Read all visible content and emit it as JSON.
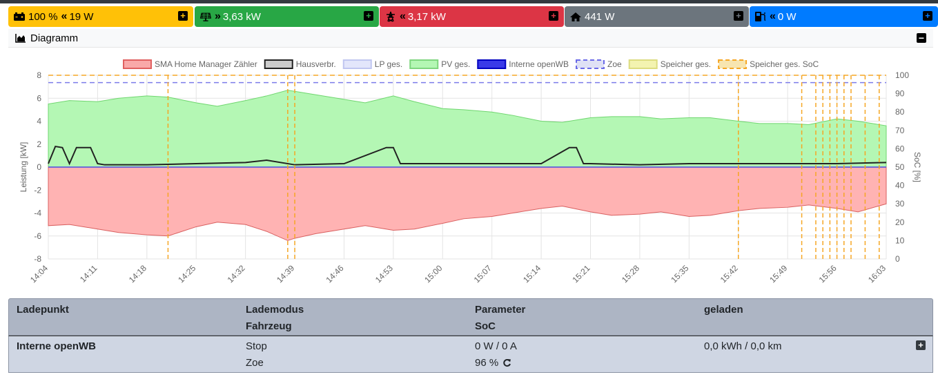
{
  "tiles": {
    "battery": {
      "value": "100 %",
      "arrow": "«",
      "power": "19 W",
      "icon": "car-battery-icon",
      "color": "#ffc107"
    },
    "pv": {
      "arrow": "»",
      "power": "3,63 kW",
      "icon": "solar-panel-icon",
      "color": "#28a745"
    },
    "grid": {
      "arrow": "«",
      "power": "3,17 kW",
      "icon": "transmission-tower-icon",
      "color": "#dc3545"
    },
    "house": {
      "power": "441 W",
      "icon": "house-icon",
      "color": "#6c757d"
    },
    "chargepoint": {
      "arrow": "«",
      "power": "0 W",
      "icon": "charging-station-icon",
      "color": "#007bff"
    }
  },
  "diagram": {
    "title": "Diagramm",
    "icon": "area-chart-icon"
  },
  "chart_data": {
    "type": "area",
    "legend": [
      {
        "name": "SMA Home Manager Zähler",
        "color": "#f9a9a9",
        "border": "#e06060",
        "dashed": false
      },
      {
        "name": "Hausverbr.",
        "color": "#cccccc",
        "border": "#222222",
        "dashed": false
      },
      {
        "name": "LP ges.",
        "color": "#e3e6fb",
        "border": "#c0c6f0",
        "dashed": false
      },
      {
        "name": "PV ges.",
        "color": "#b4f7b4",
        "border": "#7ed67e",
        "dashed": false
      },
      {
        "name": "Interne openWB",
        "color": "#3a3ae8",
        "border": "#0000c0",
        "dashed": false
      },
      {
        "name": "Zoe",
        "color": "#dfe1f5",
        "border": "#6a6ae8",
        "dashed": true
      },
      {
        "name": "Speicher ges.",
        "color": "#f3f3b0",
        "border": "#dcdc80",
        "dashed": false
      },
      {
        "name": "Speicher ges. SoC",
        "color": "#f7e5b0",
        "border": "#f5a623",
        "dashed": true
      }
    ],
    "legend_position": "top",
    "ylabel": "Leistung [kW]",
    "ylim": [
      -8,
      8
    ],
    "yticks": [
      "8",
      "6",
      "4",
      "2",
      "0",
      "-2",
      "-4",
      "-6",
      "-8"
    ],
    "y2label": "SoC [%]",
    "y2lim": [
      0,
      100
    ],
    "y2ticks": [
      "100",
      "90",
      "80",
      "70",
      "60",
      "50",
      "40",
      "30",
      "20",
      "10",
      "0"
    ],
    "xticks": [
      "14:04",
      "14:11",
      "14:18",
      "14:25",
      "14:32",
      "14:39",
      "14:46",
      "14:53",
      "15:00",
      "15:07",
      "15:14",
      "15:21",
      "15:28",
      "15:35",
      "15:42",
      "15:49",
      "15:56",
      "16:03"
    ],
    "grid": true,
    "series": [
      {
        "name": "PV ges.",
        "x": [
          "14:04",
          "14:07",
          "14:11",
          "14:14",
          "14:18",
          "14:21",
          "14:25",
          "14:28",
          "14:32",
          "14:35",
          "14:38",
          "14:39",
          "14:42",
          "14:46",
          "14:49",
          "14:53",
          "14:56",
          "15:00",
          "15:03",
          "15:07",
          "15:10",
          "15:14",
          "15:17",
          "15:21",
          "15:24",
          "15:28",
          "15:31",
          "15:35",
          "15:38",
          "15:42",
          "15:45",
          "15:49",
          "15:52",
          "15:56",
          "15:59",
          "16:03"
        ],
        "values": [
          5.5,
          5.8,
          5.7,
          6.0,
          6.2,
          6.1,
          5.6,
          5.3,
          5.8,
          6.2,
          6.7,
          6.6,
          6.3,
          5.9,
          5.6,
          6.2,
          5.7,
          5.1,
          5.0,
          4.8,
          4.5,
          4.0,
          3.9,
          4.3,
          4.4,
          4.4,
          4.2,
          4.3,
          4.3,
          4.0,
          3.8,
          3.8,
          3.7,
          4.2,
          4.0,
          3.6
        ]
      },
      {
        "name": "SMA Home Manager Zähler",
        "x": [
          "14:04",
          "14:07",
          "14:11",
          "14:14",
          "14:18",
          "14:21",
          "14:25",
          "14:28",
          "14:32",
          "14:35",
          "14:38",
          "14:39",
          "14:42",
          "14:46",
          "14:49",
          "14:53",
          "14:56",
          "15:00",
          "15:03",
          "15:07",
          "15:10",
          "15:14",
          "15:17",
          "15:21",
          "15:24",
          "15:28",
          "15:31",
          "15:35",
          "15:38",
          "15:42",
          "15:45",
          "15:49",
          "15:52",
          "15:56",
          "15:59",
          "16:03"
        ],
        "values": [
          -5.1,
          -5.0,
          -5.4,
          -5.7,
          -5.9,
          -6.0,
          -5.2,
          -4.8,
          -5.0,
          -5.6,
          -6.4,
          -6.2,
          -5.8,
          -5.4,
          -5.1,
          -5.5,
          -5.4,
          -4.9,
          -4.5,
          -4.3,
          -4.0,
          -3.6,
          -3.4,
          -3.9,
          -4.2,
          -4.1,
          -3.9,
          -4.3,
          -4.2,
          -3.8,
          -3.6,
          -3.5,
          -3.3,
          -3.6,
          -3.9,
          -3.2
        ]
      },
      {
        "name": "Hausverbr.",
        "x": [
          "14:04",
          "14:05",
          "14:06",
          "14:07",
          "14:08",
          "14:10",
          "14:11",
          "14:12",
          "14:18",
          "14:25",
          "14:32",
          "14:35",
          "14:39",
          "14:46",
          "14:52",
          "14:53",
          "14:54",
          "15:00",
          "15:07",
          "15:14",
          "15:18",
          "15:19",
          "15:20",
          "15:21",
          "15:28",
          "15:35",
          "15:42",
          "15:49",
          "15:56",
          "16:03"
        ],
        "values": [
          0.3,
          1.8,
          1.7,
          0.3,
          1.7,
          1.7,
          0.3,
          0.2,
          0.2,
          0.3,
          0.4,
          0.6,
          0.2,
          0.3,
          1.7,
          1.7,
          0.3,
          0.3,
          0.3,
          0.3,
          1.7,
          1.7,
          0.3,
          0.3,
          0.2,
          0.3,
          0.3,
          0.3,
          0.3,
          0.4
        ]
      },
      {
        "name": "Zoe",
        "axis": "SoC",
        "x": [
          "14:04",
          "16:03"
        ],
        "values": [
          96,
          96
        ]
      },
      {
        "name": "Speicher ges. SoC",
        "axis": "SoC",
        "x": [
          "14:04",
          "16:03"
        ],
        "values": [
          100,
          100
        ]
      }
    ]
  },
  "table": {
    "headers": [
      {
        "line1": "Ladepunkt",
        "line2": ""
      },
      {
        "line1": "Lademodus",
        "line2": "Fahrzeug"
      },
      {
        "line1": "Parameter",
        "line2": "SoC"
      },
      {
        "line1": "geladen",
        "line2": ""
      }
    ],
    "row": {
      "name": "Interne openWB",
      "mode": "Stop",
      "vehicle": "Zoe",
      "power": "0 W / 0 A",
      "soc": "96 %",
      "charged": "0,0 kWh / 0,0 km"
    }
  }
}
